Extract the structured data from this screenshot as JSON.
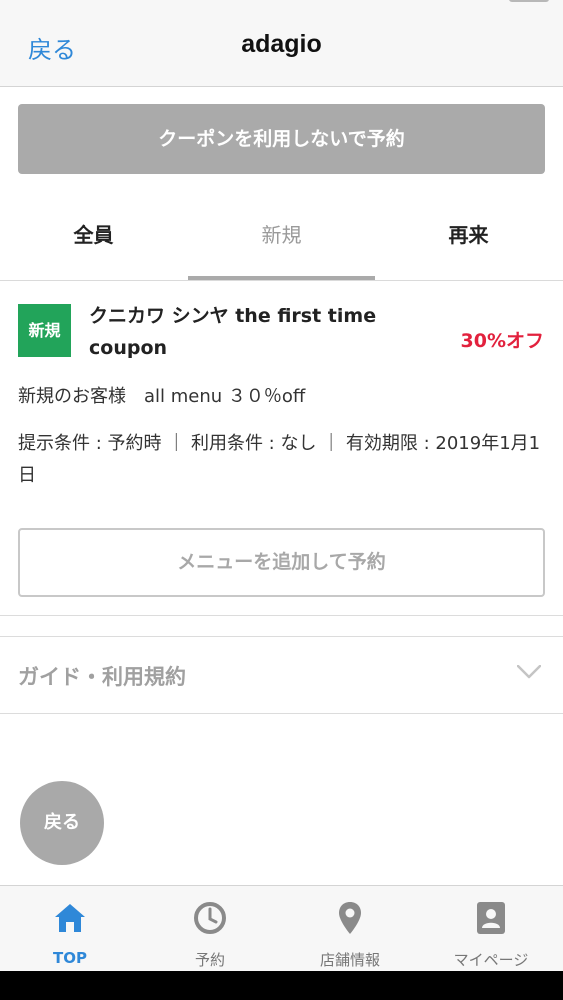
{
  "nav": {
    "back_label": "戻る",
    "title": "adagio"
  },
  "actions": {
    "no_coupon_label": "クーポンを利用しないで予約"
  },
  "tabs": [
    {
      "label": "全員"
    },
    {
      "label": "新規"
    },
    {
      "label": "再来"
    }
  ],
  "coupon": {
    "badge": "新規",
    "title": "クニカワ シンヤ the first time coupon",
    "discount": "30%オフ",
    "description": "新規のお客様　all menu ３０％off",
    "conditions": "提示条件 : 予約時 ｜ 利用条件 : なし ｜ 有効期限 : 2019年1月1日",
    "add_menu_label": "メニューを追加して予約"
  },
  "guide": {
    "label": "ガイド・利用規約"
  },
  "float_back_label": "戻る",
  "tabbar": [
    {
      "label": "TOP",
      "icon": "home-icon",
      "active": true
    },
    {
      "label": "予約",
      "icon": "clock-icon",
      "active": false
    },
    {
      "label": "店舗情報",
      "icon": "map-pin-icon",
      "active": false
    },
    {
      "label": "マイページ",
      "icon": "profile-card-icon",
      "active": false
    }
  ],
  "colors": {
    "accent": "#2f88d8",
    "new_badge": "#22a45a",
    "discount": "#e2213d"
  }
}
